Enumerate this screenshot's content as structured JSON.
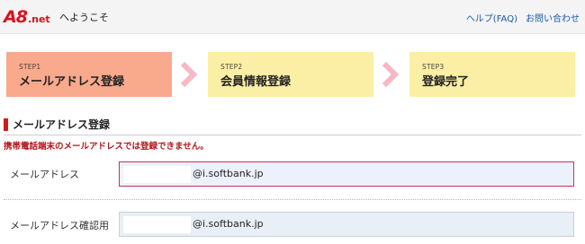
{
  "header": {
    "logo_main": "A8",
    "logo_sub": ".net",
    "welcome": "へようこそ",
    "help_link": "ヘルプ(FAQ)",
    "contact_link": "お問い合わせ"
  },
  "steps": [
    {
      "num": "STEP1",
      "title": "メールアドレス登録",
      "color": "#f9a98c",
      "active": true
    },
    {
      "num": "STEP2",
      "title": "会員情報登録",
      "color": "#fbeea5",
      "active": false
    },
    {
      "num": "STEP3",
      "title": "登録完了",
      "color": "#fbeea5",
      "active": false
    }
  ],
  "section": {
    "title": "メールアドレス登録",
    "error": "携帯電話端末のメールアドレスでは登録できません。"
  },
  "form": {
    "email_label": "メールアドレス",
    "email_value": "@i.softbank.jp",
    "confirm_label": "メールアドレス確認用",
    "confirm_value": "@i.softbank.jp"
  },
  "colors": {
    "brand_red": "#d7141e",
    "error_red": "#b3131a",
    "link_blue": "#1a5aa8",
    "chevron": "#f6b8c4"
  }
}
